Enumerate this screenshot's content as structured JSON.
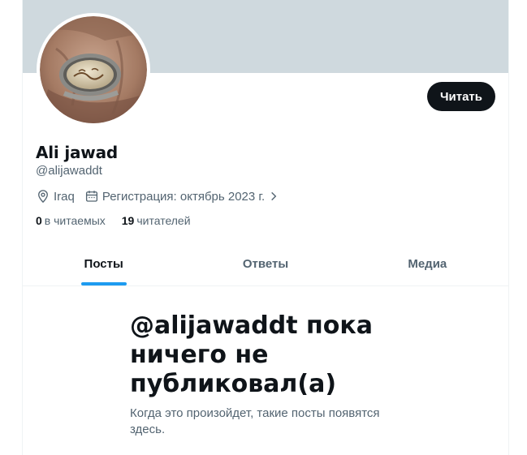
{
  "profile": {
    "name": "Ali jawad",
    "handle": "@alijawaddt",
    "location": "Iraq",
    "joined": "Регистрация: октябрь 2023 г.",
    "following_count": "0",
    "following_label": "в читаемых",
    "followers_count": "19",
    "followers_label": "читателей",
    "follow_label": "Читать"
  },
  "tabs": [
    {
      "label": "Посты",
      "active": true
    },
    {
      "label": "Ответы",
      "active": false
    },
    {
      "label": "Медиа",
      "active": false
    }
  ],
  "empty_state": {
    "title": "@alijawaddt пока ничего не публиковал(а)",
    "subtitle": "Когда это произойдет, такие посты появятся здесь."
  },
  "colors": {
    "banner": "#cfd9de",
    "accent": "#1d9bf0",
    "button": "#0f1419"
  }
}
